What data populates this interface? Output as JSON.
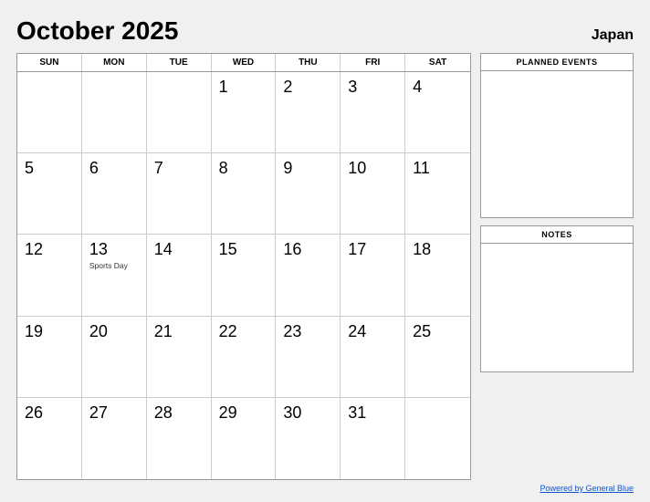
{
  "header": {
    "title": "October 2025",
    "country": "Japan"
  },
  "days": {
    "headers": [
      "SUN",
      "MON",
      "TUE",
      "WED",
      "THU",
      "FRI",
      "SAT"
    ]
  },
  "calendar": {
    "weeks": [
      [
        {
          "num": "",
          "empty": true
        },
        {
          "num": "",
          "empty": true
        },
        {
          "num": "",
          "empty": true
        },
        {
          "num": "1"
        },
        {
          "num": "2"
        },
        {
          "num": "3"
        },
        {
          "num": "4"
        }
      ],
      [
        {
          "num": "5"
        },
        {
          "num": "6"
        },
        {
          "num": "7"
        },
        {
          "num": "8"
        },
        {
          "num": "9"
        },
        {
          "num": "10"
        },
        {
          "num": "11"
        }
      ],
      [
        {
          "num": "12"
        },
        {
          "num": "13",
          "event": "Sports Day"
        },
        {
          "num": "14"
        },
        {
          "num": "15"
        },
        {
          "num": "16"
        },
        {
          "num": "17"
        },
        {
          "num": "18"
        }
      ],
      [
        {
          "num": "19"
        },
        {
          "num": "20"
        },
        {
          "num": "21"
        },
        {
          "num": "22"
        },
        {
          "num": "23"
        },
        {
          "num": "24"
        },
        {
          "num": "25"
        }
      ],
      [
        {
          "num": "26"
        },
        {
          "num": "27"
        },
        {
          "num": "28"
        },
        {
          "num": "29"
        },
        {
          "num": "30"
        },
        {
          "num": "31"
        },
        {
          "num": "",
          "empty": true
        }
      ]
    ]
  },
  "sidebar": {
    "planned_events_label": "PLANNED EVENTS",
    "notes_label": "NOTES"
  },
  "footer": {
    "link_text": "Powered by General Blue"
  }
}
